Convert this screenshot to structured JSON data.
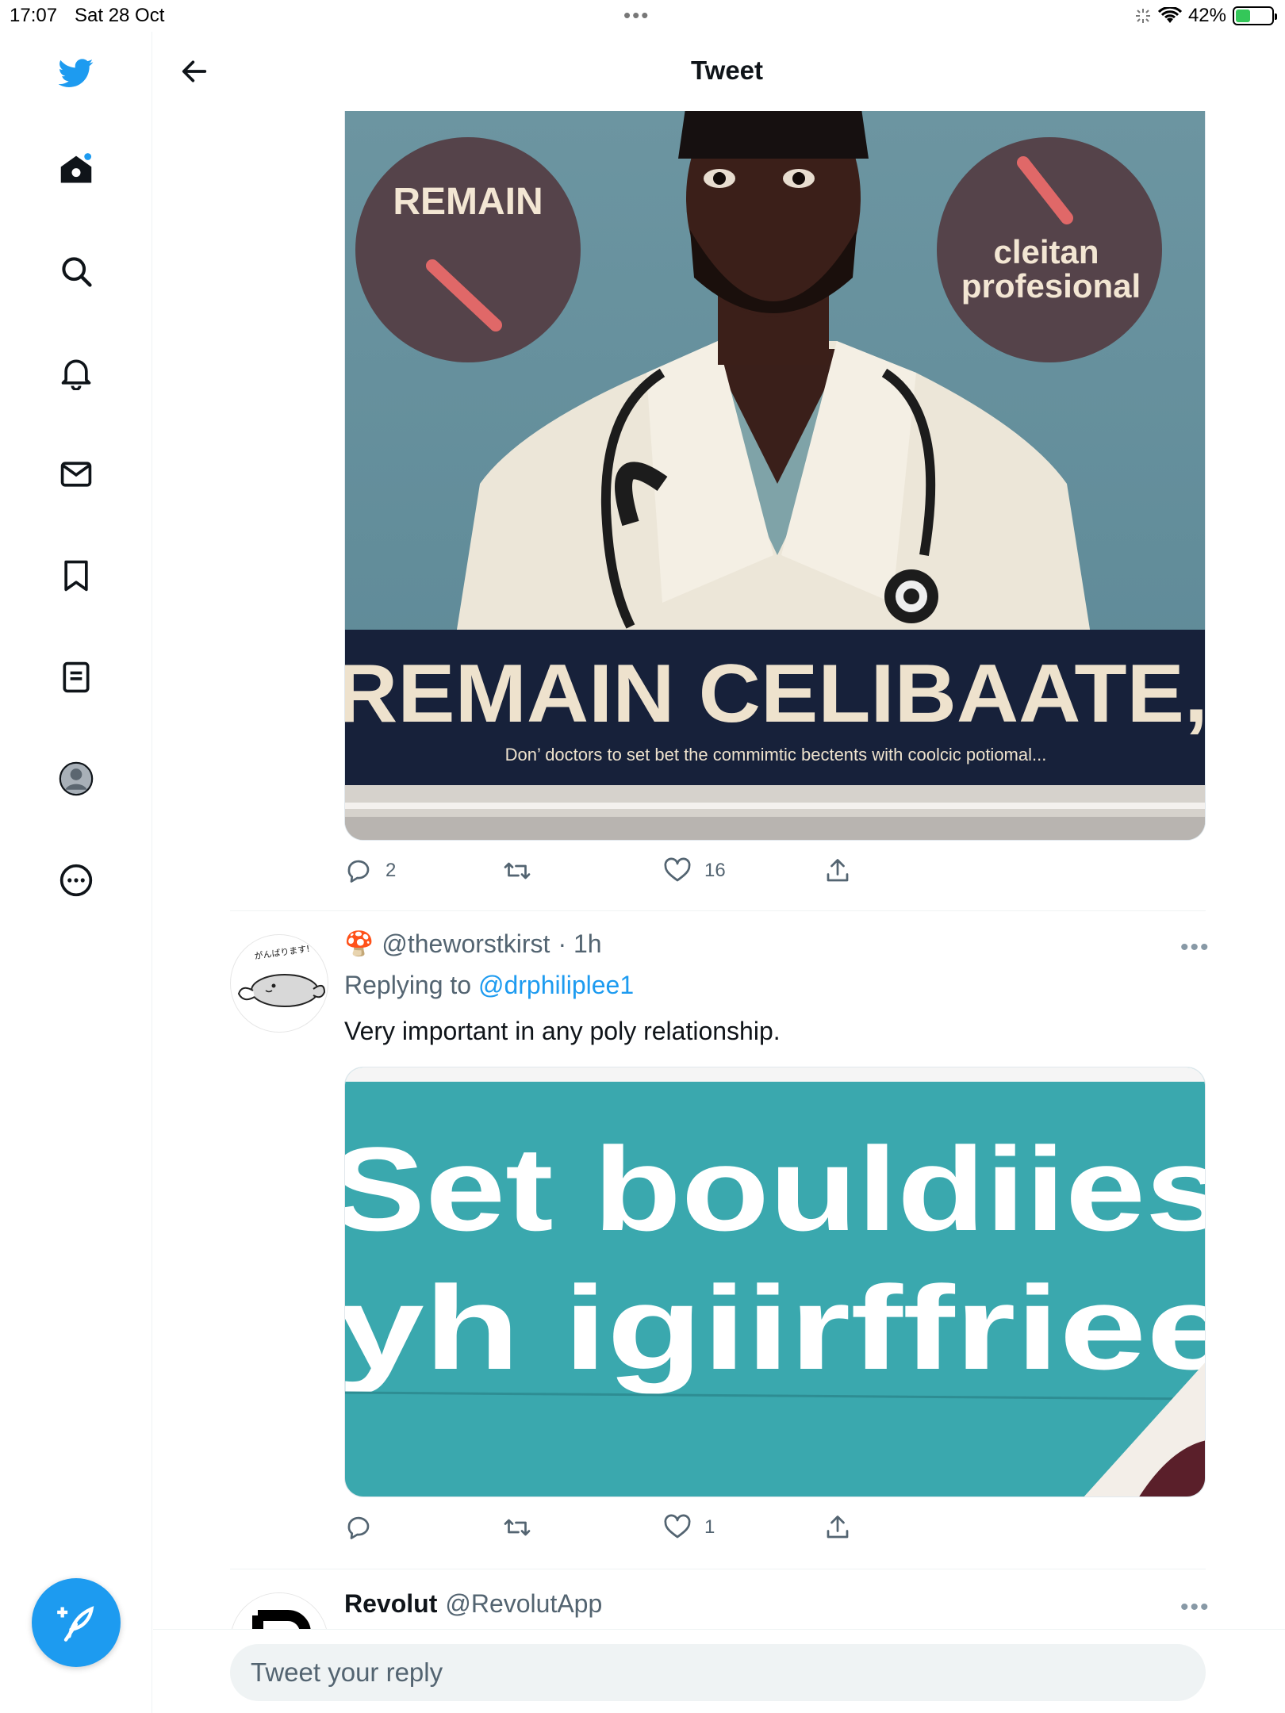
{
  "status_bar": {
    "time": "17:07",
    "date": "Sat 28 Oct",
    "battery": "42%",
    "battery_level": 0.42
  },
  "header": {
    "title": "Tweet"
  },
  "sidebar": {
    "items": [
      "home-icon",
      "search-icon",
      "bell-icon",
      "mail-icon",
      "bookmark-icon",
      "lists-icon",
      "profile-icon",
      "more-icon"
    ]
  },
  "tweet1": {
    "image_text": {
      "circle_left": "REMAIN",
      "circle_right_line1": "cleitan",
      "circle_right_line2": "profesional",
      "banner": "REMAIN CELIBAATE,",
      "banner_sub": "Don’ doctors to set bet the commimtic bectents with coolcic potiomal..."
    },
    "replies": "2",
    "retweets": "",
    "likes": "16"
  },
  "reply_tweet": {
    "emoji": "🍄",
    "handle": "@theworstkirst",
    "time": "· 1h",
    "replying_label": "Replying to",
    "replying_to": "@drphiliplee1",
    "text": "Very important in any poly relationship.",
    "avatar_text": "がんばります!",
    "image_text_line1": "Set bouldiies",
    "image_text_line2": "yh igiirffriee",
    "replies": "",
    "retweets": "",
    "likes": "1"
  },
  "next_tweet": {
    "name": "Revolut",
    "handle": "@RevolutApp"
  },
  "reply_box": {
    "placeholder": "Tweet your reply"
  },
  "colors": {
    "accent": "#1d9bf0",
    "muted": "#536471"
  }
}
